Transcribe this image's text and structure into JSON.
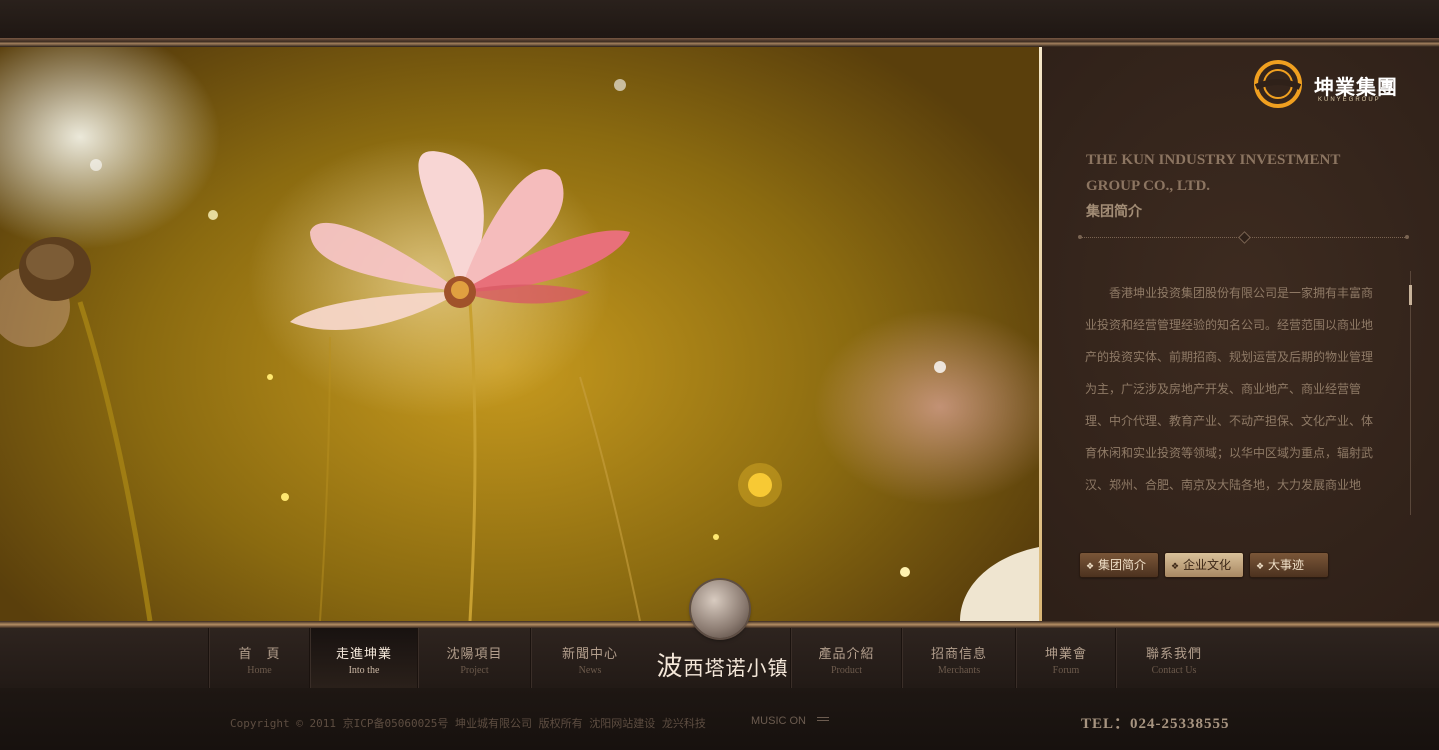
{
  "company": {
    "logo_text": "坤業集團",
    "logo_sub": "KUNYEGROUP",
    "name_en": "THE KUN INDUSTRY INVESTMENT GROUP CO., LTD.",
    "section_title": "集团简介",
    "intro": "香港坤业投资集团股份有限公司是一家拥有丰富商业投资和经营管理经验的知名公司。经营范围以商业地产的投资实体、前期招商、规划运营及后期的物业管理为主，广泛涉及房地产开发、商业地产、商业经营管理、中介代理、教育产业、不动产担保、文化产业、体育休闲和实业投资等领域；以华中区域为重点，辐射武汉、郑州、合肥、南京及大陆各地，大力发展商业地产、"
  },
  "side_buttons": [
    {
      "label": "集团简介",
      "active": false
    },
    {
      "label": "企业文化",
      "active": true
    },
    {
      "label": "大事迹",
      "active": false
    }
  ],
  "nav": [
    {
      "cn": "首　頁",
      "en": "Home",
      "active": false
    },
    {
      "cn": "走進坤業",
      "en": "Into the",
      "active": true
    },
    {
      "cn": "沈陽項目",
      "en": "Project",
      "active": false
    },
    {
      "cn": "新聞中心",
      "en": "News",
      "active": false
    },
    {
      "cn": "產品介紹",
      "en": "Product",
      "active": false
    },
    {
      "cn": "招商信息",
      "en": "Merchants",
      "active": false
    },
    {
      "cn": "坤業會",
      "en": "Forum",
      "active": false
    },
    {
      "cn": "聯系我們",
      "en": "Contact Us",
      "active": false
    }
  ],
  "center_logo": {
    "first": "波",
    "rest": "西塔诺小镇"
  },
  "footer": {
    "copyright": "Copyright © 2011 京ICP备05060025号  坤业城有限公司 版权所有  沈阳网站建设 龙兴科技",
    "music": "MUSIC ON",
    "tel": "TEL：024-25338555"
  },
  "colors": {
    "accent": "#b58e64",
    "panel": "#2f2119",
    "active_button": "#d9c19a"
  }
}
